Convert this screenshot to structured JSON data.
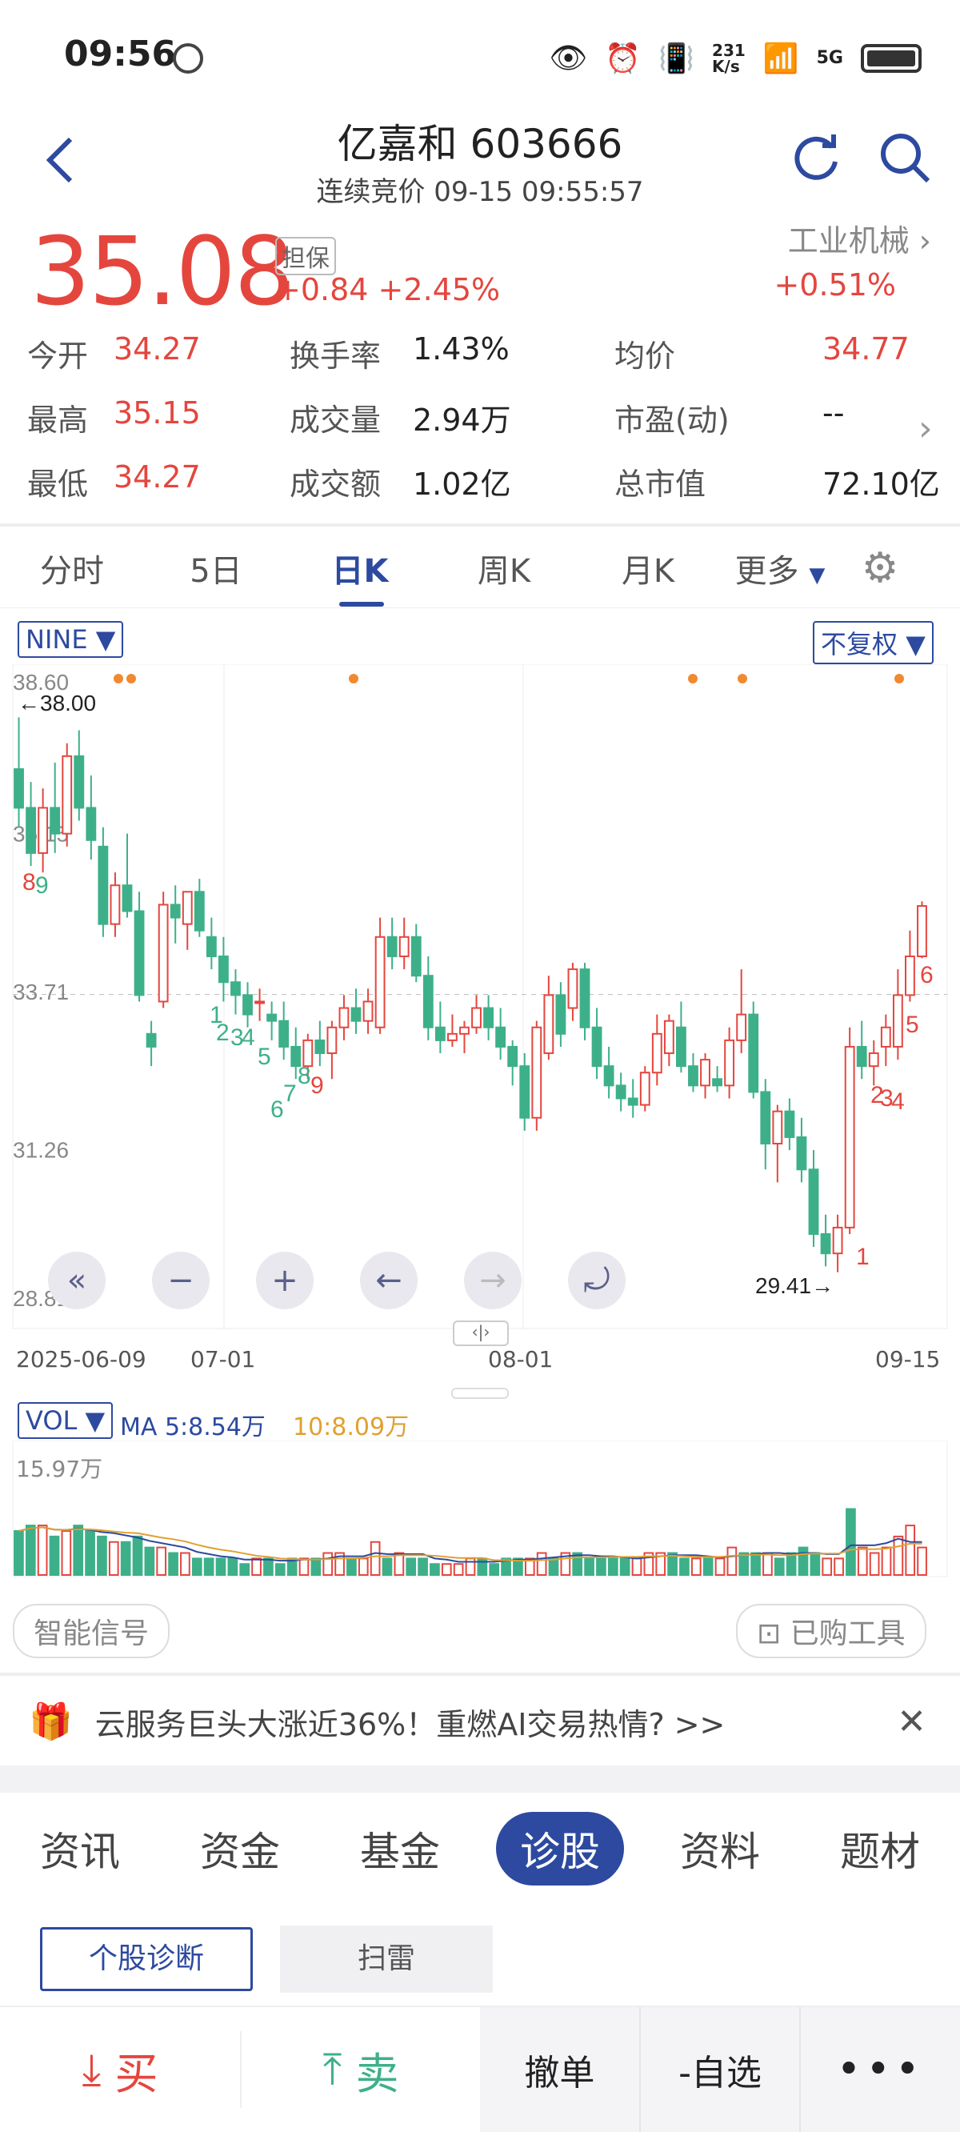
{
  "status": {
    "time": "09:56",
    "net_speed": "231\nK/s",
    "network": "5G"
  },
  "header": {
    "title": "亿嘉和 603666",
    "subtitle": "连续竞价 09-15 09:55:57"
  },
  "quote": {
    "price": "35.08",
    "badge": "担保",
    "change": "+0.84",
    "change_pct": "+2.45%",
    "sector": "工业机械",
    "sector_chg": "+0.51%"
  },
  "stats": [
    {
      "label": "今开",
      "value": "34.27",
      "color": "red"
    },
    {
      "label": "换手率",
      "value": "1.43%",
      "color": "black"
    },
    {
      "label": "均价",
      "value": "34.77",
      "color": "red"
    },
    {
      "label": "最高",
      "value": "35.15",
      "color": "red"
    },
    {
      "label": "成交量",
      "value": "2.94万",
      "color": "black"
    },
    {
      "label": "市盈(动)",
      "value": "--",
      "color": "black"
    },
    {
      "label": "最低",
      "value": "34.27",
      "color": "green"
    },
    {
      "label": "成交额",
      "value": "1.02亿",
      "color": "black"
    },
    {
      "label": "总市值",
      "value": "72.10亿",
      "color": "black"
    }
  ],
  "tabs": [
    "分时",
    "5日",
    "日K",
    "周K",
    "月K",
    "更多"
  ],
  "chart_controls": {
    "indicator": "NINE",
    "adjust": "不复权"
  },
  "chart_data": {
    "type": "candlestick",
    "yticks": [
      "38.60",
      "36.15",
      "33.71",
      "31.26",
      "28.81"
    ],
    "ylim": [
      28.81,
      38.6
    ],
    "xticks": [
      "2025-06-09",
      "07-01",
      "08-01",
      "09-15"
    ],
    "high_label": "←38.00",
    "low_label": "29.41→",
    "reference_price": 33.71,
    "candles": [
      [
        37.2,
        38.0,
        36.3,
        36.6
      ],
      [
        36.6,
        37.0,
        35.7,
        35.9
      ],
      [
        35.9,
        36.9,
        35.6,
        36.6
      ],
      [
        36.6,
        37.3,
        35.9,
        36.2
      ],
      [
        36.2,
        37.6,
        36.0,
        37.4
      ],
      [
        37.4,
        37.8,
        36.4,
        36.6
      ],
      [
        36.6,
        37.1,
        35.8,
        36.1
      ],
      [
        36.0,
        36.3,
        34.6,
        34.8
      ],
      [
        34.8,
        35.6,
        34.6,
        35.4
      ],
      [
        35.4,
        36.2,
        34.9,
        35.0
      ],
      [
        35.0,
        35.3,
        33.6,
        33.7
      ],
      [
        33.1,
        33.3,
        32.6,
        32.9
      ],
      [
        33.6,
        35.3,
        33.5,
        35.1
      ],
      [
        35.1,
        35.4,
        34.5,
        34.9
      ],
      [
        34.8,
        35.3,
        34.4,
        35.3
      ],
      [
        35.3,
        35.5,
        34.6,
        34.7
      ],
      [
        34.6,
        34.9,
        34.1,
        34.3
      ],
      [
        34.3,
        34.6,
        33.6,
        33.9
      ],
      [
        33.9,
        34.1,
        33.4,
        33.7
      ],
      [
        33.7,
        33.9,
        33.2,
        33.4
      ],
      [
        33.6,
        33.8,
        33.3,
        33.6
      ],
      [
        33.4,
        33.6,
        33.0,
        33.3
      ],
      [
        33.3,
        33.6,
        32.7,
        32.9
      ],
      [
        32.9,
        33.2,
        32.4,
        32.6
      ],
      [
        32.6,
        33.1,
        32.4,
        33.0
      ],
      [
        33.0,
        33.3,
        32.6,
        32.8
      ],
      [
        32.8,
        33.3,
        32.4,
        33.2
      ],
      [
        33.2,
        33.7,
        33.0,
        33.5
      ],
      [
        33.5,
        33.8,
        33.1,
        33.3
      ],
      [
        33.3,
        33.8,
        33.1,
        33.6
      ],
      [
        33.2,
        34.9,
        33.1,
        34.6
      ],
      [
        34.6,
        34.9,
        34.1,
        34.3
      ],
      [
        34.3,
        34.9,
        34.1,
        34.6
      ],
      [
        34.6,
        34.8,
        33.9,
        34.0
      ],
      [
        34.0,
        34.3,
        33.0,
        33.2
      ],
      [
        33.2,
        33.6,
        32.8,
        33.0
      ],
      [
        33.0,
        33.4,
        32.9,
        33.1
      ],
      [
        33.1,
        33.3,
        32.8,
        33.2
      ],
      [
        33.2,
        33.7,
        33.1,
        33.5
      ],
      [
        33.5,
        33.7,
        33.0,
        33.2
      ],
      [
        33.2,
        33.5,
        32.7,
        32.9
      ],
      [
        32.9,
        33.0,
        32.3,
        32.6
      ],
      [
        32.6,
        32.8,
        31.6,
        31.8
      ],
      [
        31.8,
        33.3,
        31.6,
        33.2
      ],
      [
        32.8,
        34.0,
        32.7,
        33.7
      ],
      [
        33.7,
        33.9,
        32.9,
        33.1
      ],
      [
        33.5,
        34.2,
        33.3,
        34.1
      ],
      [
        34.1,
        34.2,
        33.0,
        33.2
      ],
      [
        33.2,
        33.5,
        32.4,
        32.6
      ],
      [
        32.6,
        32.9,
        32.1,
        32.3
      ],
      [
        32.3,
        32.5,
        31.9,
        32.1
      ],
      [
        32.1,
        32.4,
        31.8,
        32.0
      ],
      [
        32.0,
        32.6,
        31.9,
        32.5
      ],
      [
        32.5,
        33.4,
        32.3,
        33.1
      ],
      [
        32.8,
        33.4,
        32.6,
        33.3
      ],
      [
        33.2,
        33.6,
        32.5,
        32.6
      ],
      [
        32.6,
        32.8,
        32.2,
        32.3
      ],
      [
        32.3,
        32.8,
        32.1,
        32.7
      ],
      [
        32.4,
        32.6,
        32.2,
        32.3
      ],
      [
        32.3,
        33.2,
        32.1,
        33.0
      ],
      [
        33.0,
        34.1,
        32.8,
        33.4
      ],
      [
        33.4,
        33.6,
        32.1,
        32.2
      ],
      [
        32.2,
        32.4,
        31.0,
        31.4
      ],
      [
        31.4,
        32.0,
        30.8,
        31.9
      ],
      [
        31.9,
        32.1,
        31.3,
        31.5
      ],
      [
        31.5,
        31.8,
        30.8,
        31.0
      ],
      [
        31.0,
        31.3,
        29.8,
        30.0
      ],
      [
        30.0,
        30.3,
        29.5,
        29.7
      ],
      [
        29.7,
        30.3,
        29.41,
        30.1
      ],
      [
        30.1,
        33.2,
        30.0,
        32.9
      ],
      [
        32.9,
        33.3,
        32.4,
        32.6
      ],
      [
        32.6,
        33.0,
        32.3,
        32.8
      ],
      [
        32.9,
        33.4,
        32.6,
        33.2
      ],
      [
        32.9,
        34.1,
        32.7,
        33.7
      ],
      [
        33.7,
        34.7,
        33.6,
        34.3
      ],
      [
        34.3,
        35.15,
        34.27,
        35.08
      ]
    ],
    "nine_labels": [
      "8",
      "9",
      "1",
      "2",
      "3",
      "4",
      "5",
      "6",
      "7",
      "8",
      "9",
      "1",
      "2",
      "3",
      "4",
      "5",
      "6"
    ]
  },
  "controls": [
    "rewind",
    "zoom_out",
    "zoom_in",
    "left",
    "right",
    "rotate"
  ],
  "volume": {
    "indicator": "VOL",
    "ma5": "MA 5:8.54万",
    "ma10": "10:8.09万",
    "max": "15.97万",
    "bars": [
      8,
      9,
      9,
      7,
      8,
      9,
      8,
      7,
      6,
      6,
      7,
      5,
      5,
      4,
      4,
      3,
      3,
      3,
      3,
      2,
      3,
      3,
      2,
      3,
      3,
      3,
      4,
      4,
      3,
      3,
      6,
      3,
      4,
      3,
      3,
      2,
      2,
      2,
      3,
      3,
      2,
      3,
      3,
      3,
      4,
      3,
      4,
      4,
      3,
      3,
      3,
      3,
      3,
      4,
      4,
      4,
      3,
      3,
      3,
      3,
      5,
      4,
      4,
      4,
      3,
      4,
      5,
      4,
      3,
      3,
      12,
      5,
      4,
      5,
      7,
      9,
      5
    ]
  },
  "tools": {
    "smart": "智能信号",
    "bought": "已购工具"
  },
  "banner": {
    "text": "云服务巨头大涨近36%！重燃AI交易热情? >>"
  },
  "bottom_tabs": [
    "资讯",
    "资金",
    "基金",
    "诊股",
    "资料",
    "题材"
  ],
  "sub_buttons": [
    "个股诊断",
    "扫雷"
  ],
  "footer": {
    "buy": "买",
    "sell": "卖",
    "cancel": "撤单",
    "watch": "-自选"
  }
}
